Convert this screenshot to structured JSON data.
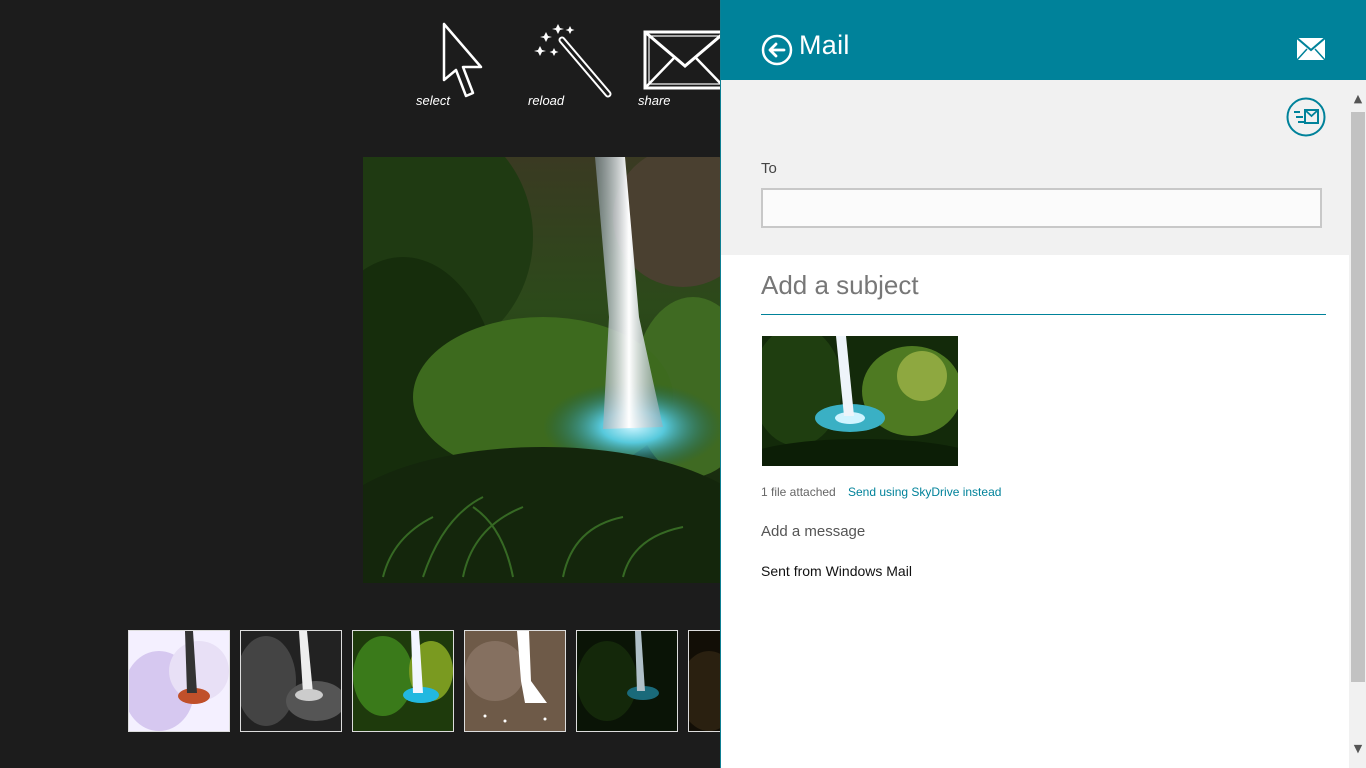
{
  "toolbar": {
    "select_label": "select",
    "reload_label": "reload",
    "share_label": "share"
  },
  "mail": {
    "title": "Mail",
    "to_label": "To",
    "to_value": "",
    "subject_placeholder": "Add a subject",
    "attached_text": "1 file attached",
    "skydrive_link": "Send using SkyDrive instead",
    "message_placeholder": "Add a message",
    "signature": "Sent from Windows Mail",
    "accent_color": "#00829a"
  },
  "thumbnails": [
    {
      "name": "inverted"
    },
    {
      "name": "grayscale"
    },
    {
      "name": "saturated"
    },
    {
      "name": "sepia-threshold"
    },
    {
      "name": "dark"
    },
    {
      "name": "partial"
    }
  ],
  "icons": [
    "cursor-icon",
    "magic-wand-icon",
    "envelope-icon",
    "back-arrow-icon",
    "mail-icon",
    "send-mail-icon"
  ]
}
